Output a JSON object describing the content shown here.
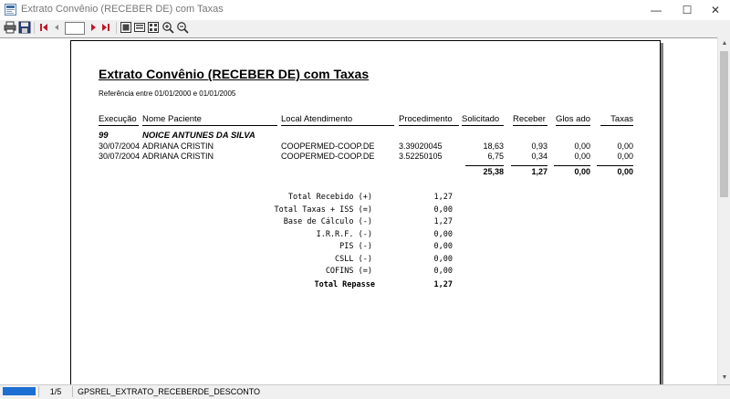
{
  "window": {
    "title": "Extrato Convênio (RECEBER DE) com Taxas",
    "minimize": "—",
    "maximize": "☐",
    "close": "✕"
  },
  "toolbar": {
    "page_value": ""
  },
  "report": {
    "title": "Extrato Convênio (RECEBER DE) com Taxas",
    "subtitle": "Referência entre 01/01/2000 e 01/01/2005",
    "columns": [
      "Execução",
      "Nome Paciente",
      "Local Atendimento",
      "Procedimento",
      "Solicitado",
      "Receber",
      "Glos ado",
      "Taxas"
    ],
    "group": {
      "code": "99",
      "name": "NOICE ANTUNES DA SILVA"
    },
    "rows": [
      [
        "30/07/2004",
        "ADRIANA CRISTIN",
        "COOPERMED-COOP.DE",
        "3.39020045",
        "18,63",
        "0,93",
        "0,00",
        "0,00"
      ],
      [
        "30/07/2004",
        "ADRIANA CRISTIN",
        "COOPERMED-COOP.DE",
        "3.52250105",
        "6,75",
        "0,34",
        "0,00",
        "0,00"
      ]
    ],
    "totals": [
      "25,38",
      "1,27",
      "0,00",
      "0,00"
    ],
    "summary": [
      {
        "label": "Total Recebido (+)",
        "value": "1,27"
      },
      {
        "label": "Total Taxas + ISS (=)",
        "value": "0,00"
      },
      {
        "label": "Base de Cálculo (-)",
        "value": "1,27"
      },
      {
        "label": "I.R.R.F. (-)",
        "value": "0,00"
      },
      {
        "label": "PIS (-)",
        "value": "0,00"
      },
      {
        "label": "CSLL (-)",
        "value": "0,00"
      },
      {
        "label": "COFINS (=)",
        "value": "0,00"
      },
      {
        "label": "Total Repasse",
        "value": "1,27"
      }
    ]
  },
  "status": {
    "progress": 1.0,
    "page": "1/5",
    "report_name": "GPSREL_EXTRATO_RECEBERDE_DESCONTO"
  },
  "colors": {
    "progress": "#1d6ed2",
    "nav_red": "#c0182a",
    "title_text": "#777777"
  }
}
